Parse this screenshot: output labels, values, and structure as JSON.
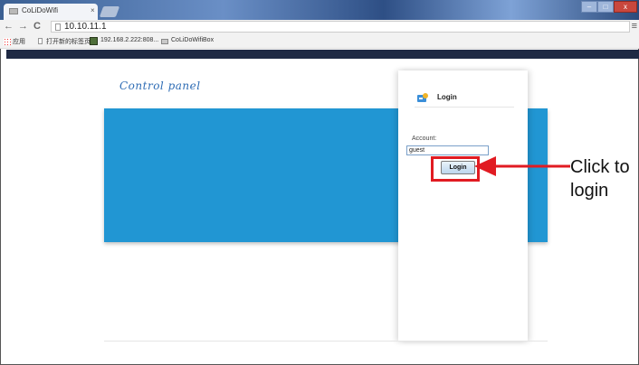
{
  "browser": {
    "tab_title": "CoLiDoWifi",
    "tab_close": "×",
    "url": "10.10.11.1",
    "nav": {
      "back": "←",
      "forward": "→",
      "reload": "C"
    },
    "menu": "≡",
    "window_controls": {
      "minimize": "–",
      "maximize": "□",
      "close": "x"
    }
  },
  "bookmarks": [
    {
      "label": "应用"
    },
    {
      "label": "打开新的标签页"
    },
    {
      "label": "192.168.2.222:808..."
    },
    {
      "label": "CoLiDoWifiBox"
    }
  ],
  "page": {
    "title": "Control panel",
    "login": {
      "title": "Login",
      "account_label": "Account:",
      "account_value": "guest",
      "button_label": "Login"
    },
    "callout": "Click to\nlogin"
  },
  "colors": {
    "topbar": "#1f2a44",
    "panel_blue": "#2196d3",
    "highlight_red": "#e11b22",
    "title_blue": "#2f6db5"
  }
}
